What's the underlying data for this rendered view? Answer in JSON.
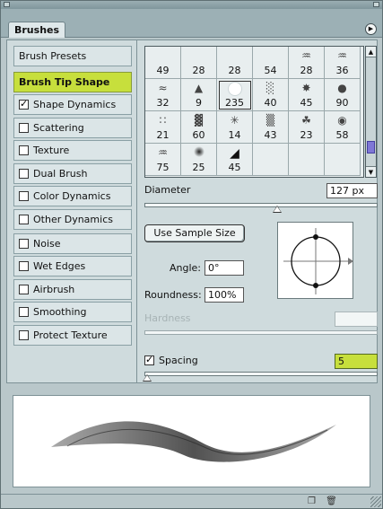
{
  "panel": {
    "tab_label": "Brushes",
    "menu_icon": "circle-arrow-icon"
  },
  "sidebar": {
    "items": [
      {
        "label": "Brush Presets",
        "checkbox": false,
        "checked": false,
        "selected": false
      },
      {
        "label": "Brush Tip Shape",
        "checkbox": false,
        "checked": false,
        "selected": true
      },
      {
        "label": "Shape Dynamics",
        "checkbox": true,
        "checked": true,
        "selected": false
      },
      {
        "label": "Scattering",
        "checkbox": true,
        "checked": false,
        "selected": false
      },
      {
        "label": "Texture",
        "checkbox": true,
        "checked": false,
        "selected": false
      },
      {
        "label": "Dual Brush",
        "checkbox": true,
        "checked": false,
        "selected": false
      },
      {
        "label": "Color Dynamics",
        "checkbox": true,
        "checked": false,
        "selected": false
      },
      {
        "label": "Other Dynamics",
        "checkbox": true,
        "checked": false,
        "selected": false
      },
      {
        "label": "Noise",
        "checkbox": true,
        "checked": false,
        "selected": false
      },
      {
        "label": "Wet Edges",
        "checkbox": true,
        "checked": false,
        "selected": false
      },
      {
        "label": "Airbrush",
        "checkbox": true,
        "checked": false,
        "selected": false
      },
      {
        "label": "Smoothing",
        "checkbox": true,
        "checked": false,
        "selected": false
      },
      {
        "label": "Protect Texture",
        "checkbox": true,
        "checked": false,
        "selected": false
      }
    ]
  },
  "brush_grid": {
    "cells": [
      {
        "size": "49",
        "icon": "soft-round"
      },
      {
        "size": "28",
        "icon": "soft-round"
      },
      {
        "size": "28",
        "icon": "soft-round"
      },
      {
        "size": "54",
        "icon": "soft-round"
      },
      {
        "size": "28",
        "icon": "grass-stroke"
      },
      {
        "size": "36",
        "icon": "grass-stroke"
      },
      {
        "size": "32",
        "icon": "scatter-leaves"
      },
      {
        "size": "9",
        "icon": "triangle"
      },
      {
        "size": "235",
        "icon": "large-soft-round"
      },
      {
        "size": "40",
        "icon": "chalk"
      },
      {
        "size": "45",
        "icon": "splatter"
      },
      {
        "size": "90",
        "icon": "texture-round"
      },
      {
        "size": "21",
        "icon": "scatter-dots"
      },
      {
        "size": "60",
        "icon": "texture-blob"
      },
      {
        "size": "14",
        "icon": "star-spray"
      },
      {
        "size": "43",
        "icon": "spray"
      },
      {
        "size": "23",
        "icon": "maple-leaf"
      },
      {
        "size": "58",
        "icon": "sponge"
      },
      {
        "size": "75",
        "icon": "feather-stroke"
      },
      {
        "size": "25",
        "icon": "soft-dot"
      },
      {
        "size": "45",
        "icon": "leaf"
      },
      {
        "size": "",
        "icon": ""
      },
      {
        "size": "",
        "icon": ""
      },
      {
        "size": "",
        "icon": ""
      }
    ],
    "selected_index": 8
  },
  "diameter": {
    "label": "Diameter",
    "value": "127 px",
    "slider_fraction": 0.57
  },
  "use_sample_size_label": "Use Sample Size",
  "angle": {
    "label": "Angle:",
    "value": "0°"
  },
  "roundness": {
    "label": "Roundness:",
    "value": "100%"
  },
  "hardness": {
    "label": "Hardness",
    "value": "",
    "disabled": true
  },
  "spacing": {
    "label": "Spacing",
    "checked": true,
    "value": "5",
    "slider_fraction": 0.0
  },
  "colors": {
    "accent": "#c7df3c",
    "scroll_thumb": "#7f77d6"
  },
  "status_icons": [
    "new-brush-icon",
    "trash-icon"
  ]
}
